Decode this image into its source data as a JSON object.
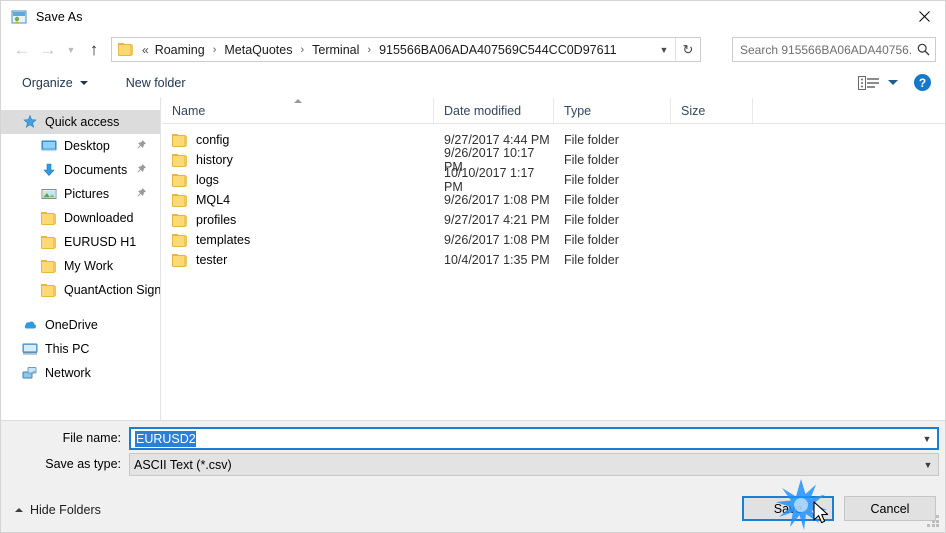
{
  "window": {
    "title": "Save As",
    "icon": "save-as-icon",
    "close_label": "✕"
  },
  "nav": {
    "back": "←",
    "forward": "→",
    "recent": "⌄",
    "up": "↑"
  },
  "address": {
    "folder_icon": "folder-icon",
    "overflow": "«",
    "crumbs": [
      "Roaming",
      "MetaQuotes",
      "Terminal",
      "915566BA06ADA407569C544CC0D97611"
    ],
    "separator": "›",
    "dropdown": "⌄",
    "refresh": "↻"
  },
  "search": {
    "placeholder": "Search 915566BA06ADA40756...",
    "icon": "search-icon"
  },
  "toolbar": {
    "organize": "Organize",
    "new_folder": "New folder",
    "view_icon": "view-layout-icon",
    "help": "?"
  },
  "sidebar": {
    "items": [
      {
        "label": "Quick access",
        "icon": "quick-access-star-icon",
        "level": 0,
        "selected": true,
        "pinned": false
      },
      {
        "label": "Desktop",
        "icon": "desktop-icon",
        "level": 1,
        "selected": false,
        "pinned": true
      },
      {
        "label": "Documents",
        "icon": "documents-download-icon",
        "level": 1,
        "selected": false,
        "pinned": true
      },
      {
        "label": "Pictures",
        "icon": "pictures-icon",
        "level": 1,
        "selected": false,
        "pinned": true
      },
      {
        "label": "Downloaded",
        "icon": "folder-icon",
        "level": 1,
        "selected": false,
        "pinned": false
      },
      {
        "label": "EURUSD H1",
        "icon": "folder-icon",
        "level": 1,
        "selected": false,
        "pinned": false
      },
      {
        "label": "My Work",
        "icon": "folder-icon",
        "level": 1,
        "selected": false,
        "pinned": false
      },
      {
        "label": "QuantAction Signal",
        "icon": "folder-icon",
        "level": 1,
        "selected": false,
        "pinned": false
      },
      {
        "label": "OneDrive",
        "icon": "onedrive-cloud-icon",
        "level": 0,
        "selected": false,
        "pinned": false
      },
      {
        "label": "This PC",
        "icon": "this-pc-icon",
        "level": 0,
        "selected": false,
        "pinned": false
      },
      {
        "label": "Network",
        "icon": "network-icon",
        "level": 0,
        "selected": false,
        "pinned": false
      }
    ]
  },
  "filelist": {
    "columns": [
      "Name",
      "Date modified",
      "Type",
      "Size"
    ],
    "sorted_by": "Name",
    "sort_direction": "ascending",
    "rows": [
      {
        "name": "config",
        "date": "9/27/2017 4:44 PM",
        "type": "File folder",
        "size": ""
      },
      {
        "name": "history",
        "date": "9/26/2017 10:17 PM",
        "type": "File folder",
        "size": ""
      },
      {
        "name": "logs",
        "date": "10/10/2017 1:17 PM",
        "type": "File folder",
        "size": ""
      },
      {
        "name": "MQL4",
        "date": "9/26/2017 1:08 PM",
        "type": "File folder",
        "size": ""
      },
      {
        "name": "profiles",
        "date": "9/27/2017 4:21 PM",
        "type": "File folder",
        "size": ""
      },
      {
        "name": "templates",
        "date": "9/26/2017 1:08 PM",
        "type": "File folder",
        "size": ""
      },
      {
        "name": "tester",
        "date": "10/4/2017 1:35 PM",
        "type": "File folder",
        "size": ""
      }
    ]
  },
  "form": {
    "filename_label": "File name:",
    "filename_value": "EURUSD2",
    "filetype_label": "Save as type:",
    "filetype_value": "ASCII Text (*.csv)",
    "dropdown_glyph": "⌄"
  },
  "footer": {
    "hide_folders": "Hide Folders",
    "save": "Save",
    "cancel": "Cancel"
  },
  "colors": {
    "accent": "#1a7fd4",
    "folder": "#fcd975",
    "selection": "#2a7fd6",
    "help_blue": "#1878c8"
  }
}
